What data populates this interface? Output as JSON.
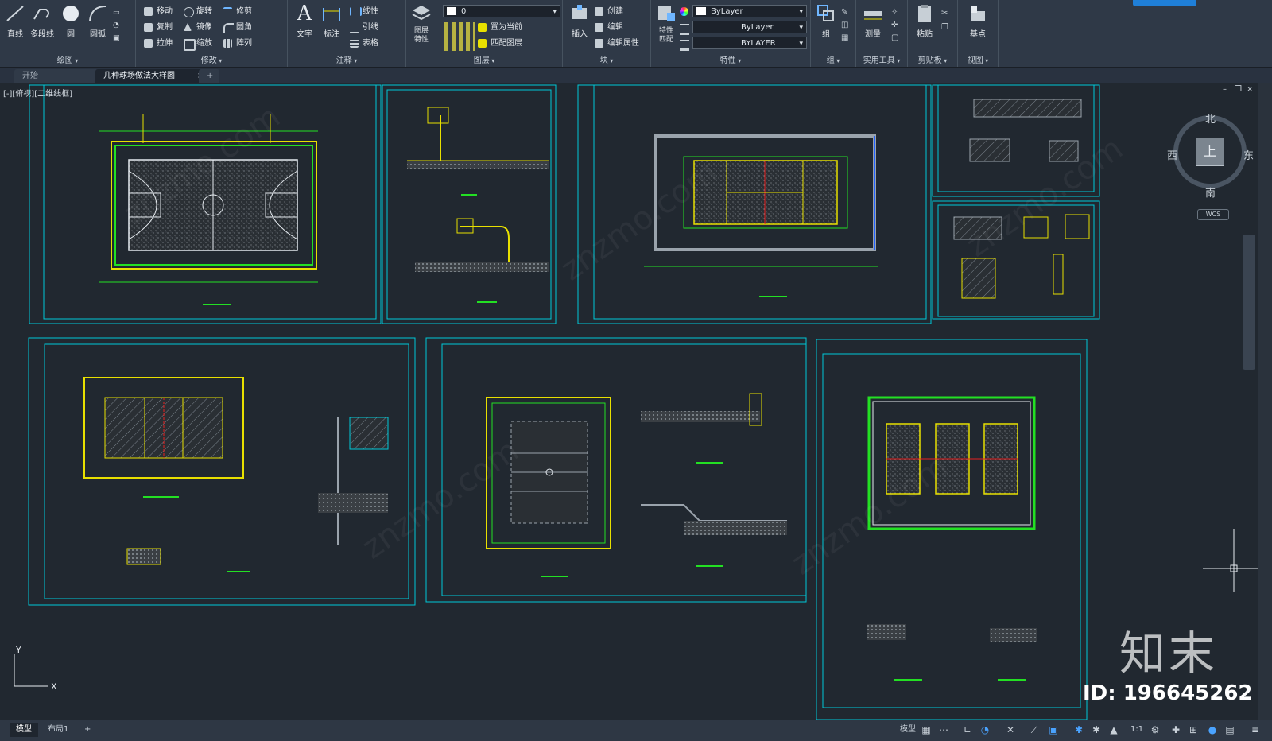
{
  "ribbon": {
    "draw": {
      "title": "绘图",
      "line": "直线",
      "polyline": "多段线",
      "circle": "圆",
      "arc": "圆弧"
    },
    "modify": {
      "title": "修改",
      "move": "移动",
      "rotate": "旋转",
      "trim": "修剪",
      "copy": "复制",
      "mirror": "镜像",
      "fillet": "圆角",
      "stretch": "拉伸",
      "scale": "缩放",
      "array": "阵列"
    },
    "annotation": {
      "title": "注释",
      "text": "文字",
      "dimension": "标注",
      "linear": "线性",
      "leader": "引线",
      "table": "表格"
    },
    "layers": {
      "title": "图层",
      "layer_props": "图层\n特性",
      "current_layer": "0",
      "set_current": "置为当前",
      "match_layer": "匹配图层"
    },
    "block": {
      "title": "块",
      "insert": "插入",
      "create": "创建",
      "edit": "编辑",
      "edit_attr": "编辑属性"
    },
    "properties": {
      "title": "特性",
      "match": "特性\n匹配",
      "color": "ByLayer",
      "linetype": "ByLayer",
      "lineweight": "BYLAYER"
    },
    "group": {
      "title": "组",
      "group": "组"
    },
    "utilities": {
      "title": "实用工具",
      "measure": "测量"
    },
    "clipboard": {
      "title": "剪贴板",
      "paste": "粘贴"
    },
    "view": {
      "title": "视图",
      "base": "基点"
    }
  },
  "tabs": [
    {
      "label": "开始"
    },
    {
      "label": "几种球场做法大样图"
    }
  ],
  "viewport": {
    "label": "[-][俯视][二维线框]",
    "compass": {
      "north": "北",
      "south": "南",
      "east": "东",
      "west": "西",
      "top": "上",
      "wcs": "WCS"
    },
    "watermark_id": "ID: 196645262",
    "watermark_logo": "知末",
    "watermark_text": "znzmo.com"
  },
  "status": {
    "tabs": [
      {
        "label": "模型"
      },
      {
        "label": "布局1"
      }
    ],
    "model": "模型",
    "scale": "1:1"
  },
  "colors": {
    "cyan": "#00c8d8",
    "green": "#23e023",
    "yellow": "#e8e000",
    "bg": "#212830",
    "gray": "#9aa3ac"
  }
}
